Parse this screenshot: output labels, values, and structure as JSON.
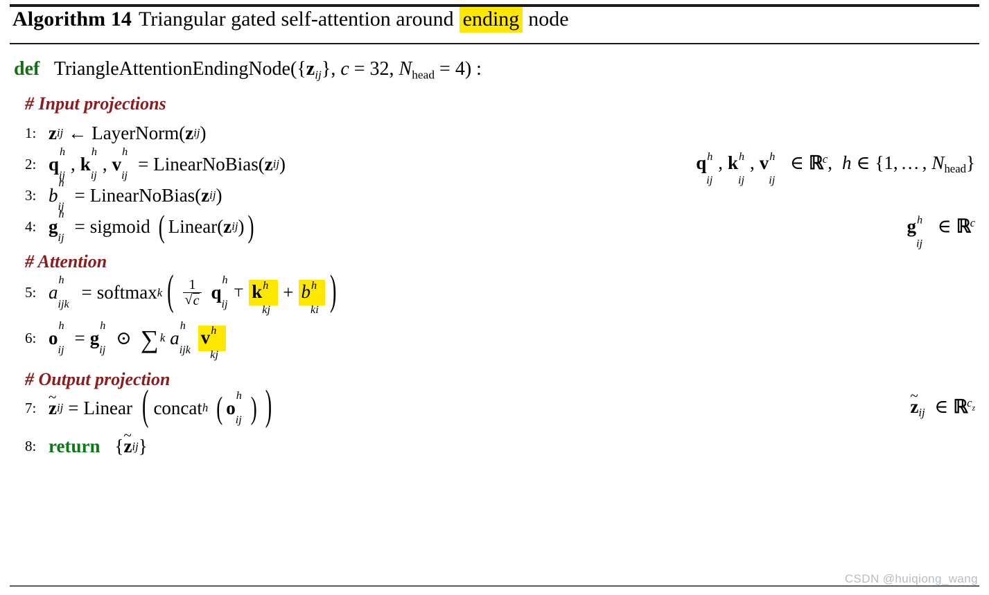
{
  "algorithm": {
    "label": "Algorithm 14",
    "title_before": "Triangular gated self-attention around",
    "title_highlight": "ending",
    "title_after": "node",
    "highlight_color": "#ffe800",
    "comment_color": "#8d1b1b",
    "keyword_color": "#127012"
  },
  "signature": {
    "keyword": "def",
    "name": "TriangleAttentionEndingNode",
    "args_text": "({z_ij}, c = 32, N_head = 4) :",
    "arg_tensor": "z",
    "arg_tensor_sub": "ij",
    "param_c_name": "c",
    "param_c_value": "32",
    "param_n_name": "N",
    "param_n_sub": "head",
    "param_n_value": "4"
  },
  "sections": {
    "input_projections": "# Input projections",
    "attention": "# Attention",
    "output_projection": "# Output projection"
  },
  "lines": [
    {
      "no": "1:",
      "lhs_var": "z",
      "lhs_sub": "ij",
      "op": "←",
      "fn": "LayerNorm",
      "arg_var": "z",
      "arg_sub": "ij",
      "rhs": ""
    },
    {
      "no": "2:",
      "vars": [
        "q",
        "k",
        "v"
      ],
      "sup": "h",
      "sub": "ij",
      "op": "=",
      "fn": "LinearNoBias",
      "arg_var": "z",
      "arg_sub": "ij",
      "rhs_set": "ℝ",
      "rhs_sup": "c",
      "rhs_h": "h",
      "rhs_in": "∈",
      "rhs_range": "{1, … , N_head}"
    },
    {
      "no": "3:",
      "lhs_var": "b",
      "lhs_sup": "h",
      "lhs_sub": "ij",
      "op": "=",
      "fn": "LinearNoBias",
      "arg_var": "z",
      "arg_sub": "ij",
      "rhs": ""
    },
    {
      "no": "4:",
      "lhs_var": "g",
      "lhs_sup": "h",
      "lhs_sub": "ij",
      "op": "=",
      "fn": "sigmoid",
      "inner_fn": "Linear",
      "arg_var": "z",
      "arg_sub": "ij",
      "rhs_var": "g",
      "rhs_sup": "h",
      "rhs_sub": "ij",
      "rhs_in": "∈",
      "rhs_set": "ℝ",
      "rhs_set_sup": "c"
    },
    {
      "no": "5:",
      "lhs_var": "a",
      "lhs_sup": "h",
      "lhs_sub": "ijk",
      "op": "=",
      "fn": "softmax",
      "fn_sub": "k",
      "frac_num": "1",
      "frac_den": "c",
      "q_var": "q",
      "q_sup": "h",
      "q_sub": "ij",
      "transpose": "⊤",
      "k_var": "k",
      "k_sup": "h",
      "k_sub": "kj",
      "k_highlight": true,
      "plus": "+",
      "b_var": "b",
      "b_sup": "h",
      "b_sub": "ki",
      "b_highlight": true
    },
    {
      "no": "6:",
      "lhs_var": "o",
      "lhs_sup": "h",
      "lhs_sub": "ij",
      "op": "=",
      "g_var": "g",
      "g_sup": "h",
      "g_sub": "ij",
      "hadamard": "⊙",
      "sum": "∑",
      "sum_sub": "k",
      "a_var": "a",
      "a_sup": "h",
      "a_sub": "ijk",
      "v_var": "v",
      "v_sup": "h",
      "v_sub": "kj",
      "v_highlight": true
    },
    {
      "no": "7:",
      "lhs_var": "z",
      "lhs_tilde": "~",
      "lhs_sub": "ij",
      "op": "=",
      "fn": "Linear",
      "inner_fn": "concat",
      "inner_fn_sub": "h",
      "arg_var": "o",
      "arg_sup": "h",
      "arg_sub": "ij",
      "rhs_var": "z",
      "rhs_sub": "ij",
      "rhs_in": "∈",
      "rhs_set": "ℝ",
      "rhs_set_sup": "c",
      "rhs_set_sup_sub": "z"
    },
    {
      "no": "8:",
      "keyword": "return",
      "ret_var": "z",
      "ret_sub": "ij",
      "ret_open": "{",
      "ret_close": "}"
    }
  ],
  "watermark": "CSDN @huiqiong_wang"
}
